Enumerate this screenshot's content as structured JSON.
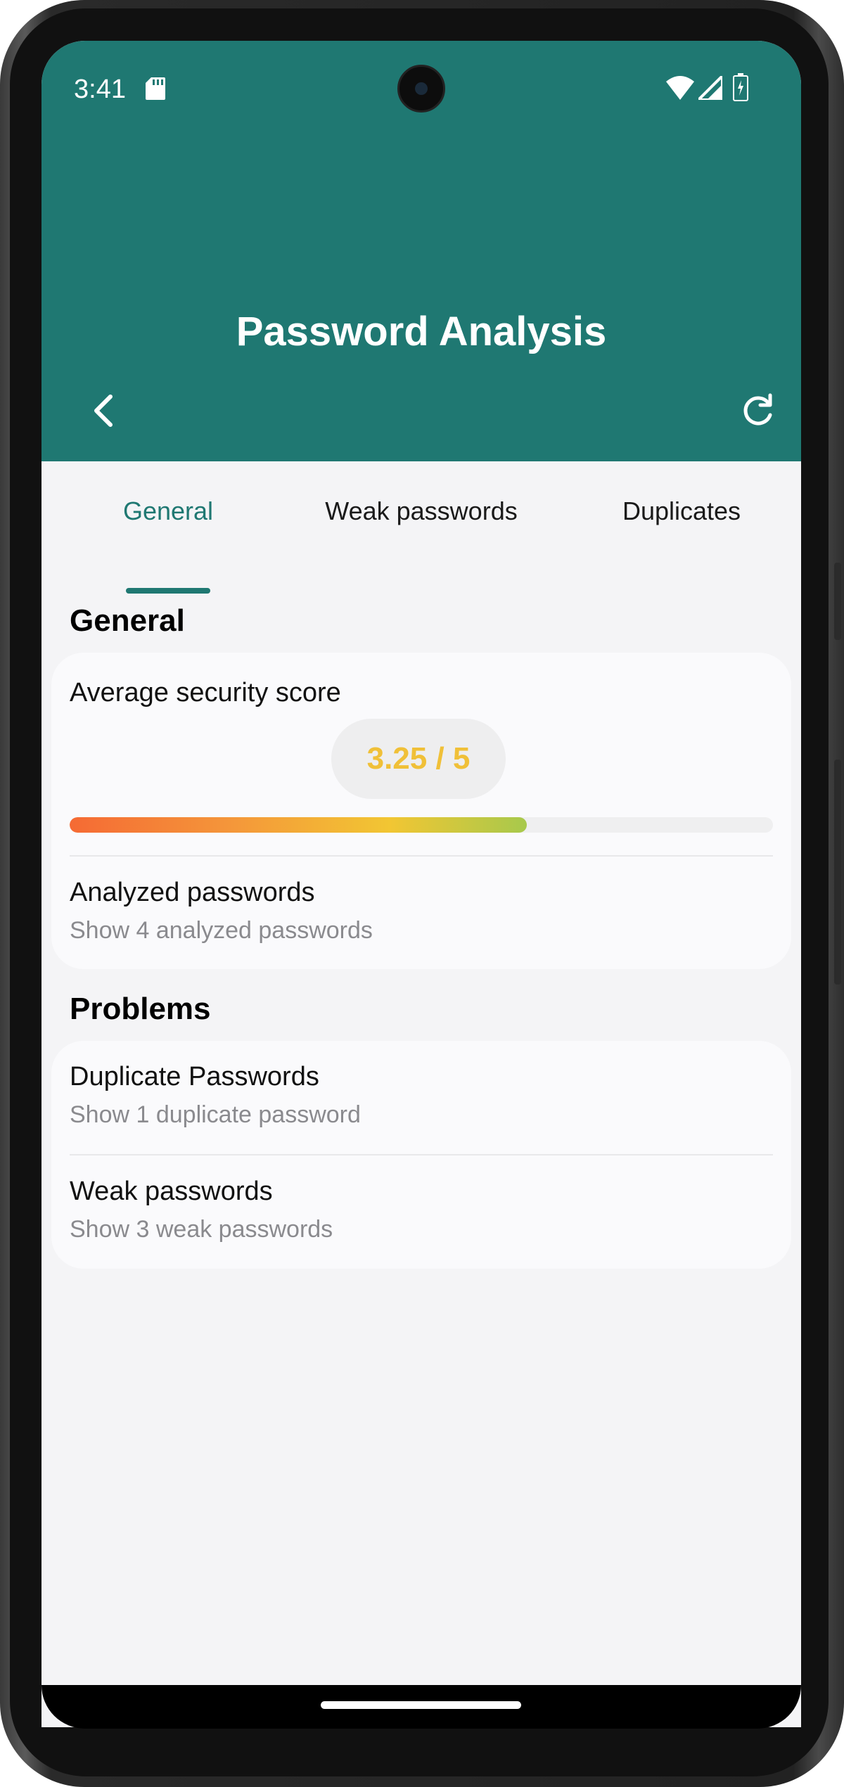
{
  "status_bar": {
    "time": "3:41",
    "icons": [
      "sd-card-icon",
      "wifi-icon",
      "signal-icon",
      "battery-icon"
    ]
  },
  "header": {
    "title": "Password Analysis",
    "background_color": "#1f7872",
    "back_icon": "chevron-left-icon",
    "refresh_icon": "refresh-icon"
  },
  "tabs": [
    {
      "label": "General",
      "active": true
    },
    {
      "label": "Weak passwords",
      "active": false
    },
    {
      "label": "Duplicates",
      "active": false
    }
  ],
  "general": {
    "heading": "General",
    "score_label": "Average security score",
    "score_text": "3.25 / 5",
    "score_fraction": 0.65,
    "analyzed_title": "Analyzed passwords",
    "analyzed_sub": "Show 4 analyzed passwords"
  },
  "problems": {
    "heading": "Problems",
    "items": [
      {
        "title": "Duplicate Passwords",
        "sub": "Show 1 duplicate password"
      },
      {
        "title": "Weak passwords",
        "sub": "Show 3 weak passwords"
      }
    ]
  },
  "colors": {
    "accent": "#1f7872",
    "score": "#f0c038",
    "progress_start": "#f56a34",
    "progress_end": "#a7c94c"
  }
}
